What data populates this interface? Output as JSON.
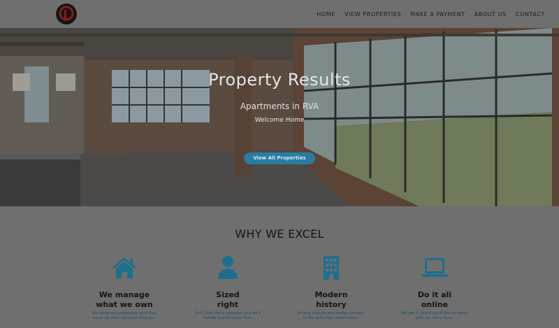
{
  "header": {
    "logo_name": "brand-logo",
    "nav": [
      {
        "label": "HOME"
      },
      {
        "label": "VIEW PROPERTIES"
      },
      {
        "label": "MAKE A PAYMENT"
      },
      {
        "label": "ABOUT US"
      },
      {
        "label": "CONTACT"
      }
    ]
  },
  "hero": {
    "title": "Property Results",
    "subtitle": "Apartments in RVA",
    "welcome": "Welcome Home",
    "button_label": "View All Properties"
  },
  "why": {
    "title": "WHY WE EXCEL",
    "features": [
      {
        "icon": "home-icon",
        "title_line1": "We manage",
        "title_line2": "what we own",
        "text_line1": "We serve our properties as if they",
        "text_line2": "were our own, because they are."
      },
      {
        "icon": "user-icon",
        "title_line1": "Sized",
        "title_line2": "right",
        "text_line1": "You'll feel like a neighbor and we'll",
        "text_line2": "handle maintenance fast."
      },
      {
        "icon": "building-icon",
        "title_line1": "Modern",
        "title_line2": "history",
        "text_line1": "Unique layouts and design brought",
        "text_line2": "to life with new construction."
      },
      {
        "icon": "laptop-icon",
        "title_line1": "Do it all",
        "title_line2": "online",
        "text_line1": "We get it. But if you'd like to speak",
        "text_line2": "with us, we're here."
      }
    ]
  },
  "colors": {
    "accent": "#1e6f8e",
    "button": "#2a7da1",
    "overlay": "#6f6f6f"
  }
}
